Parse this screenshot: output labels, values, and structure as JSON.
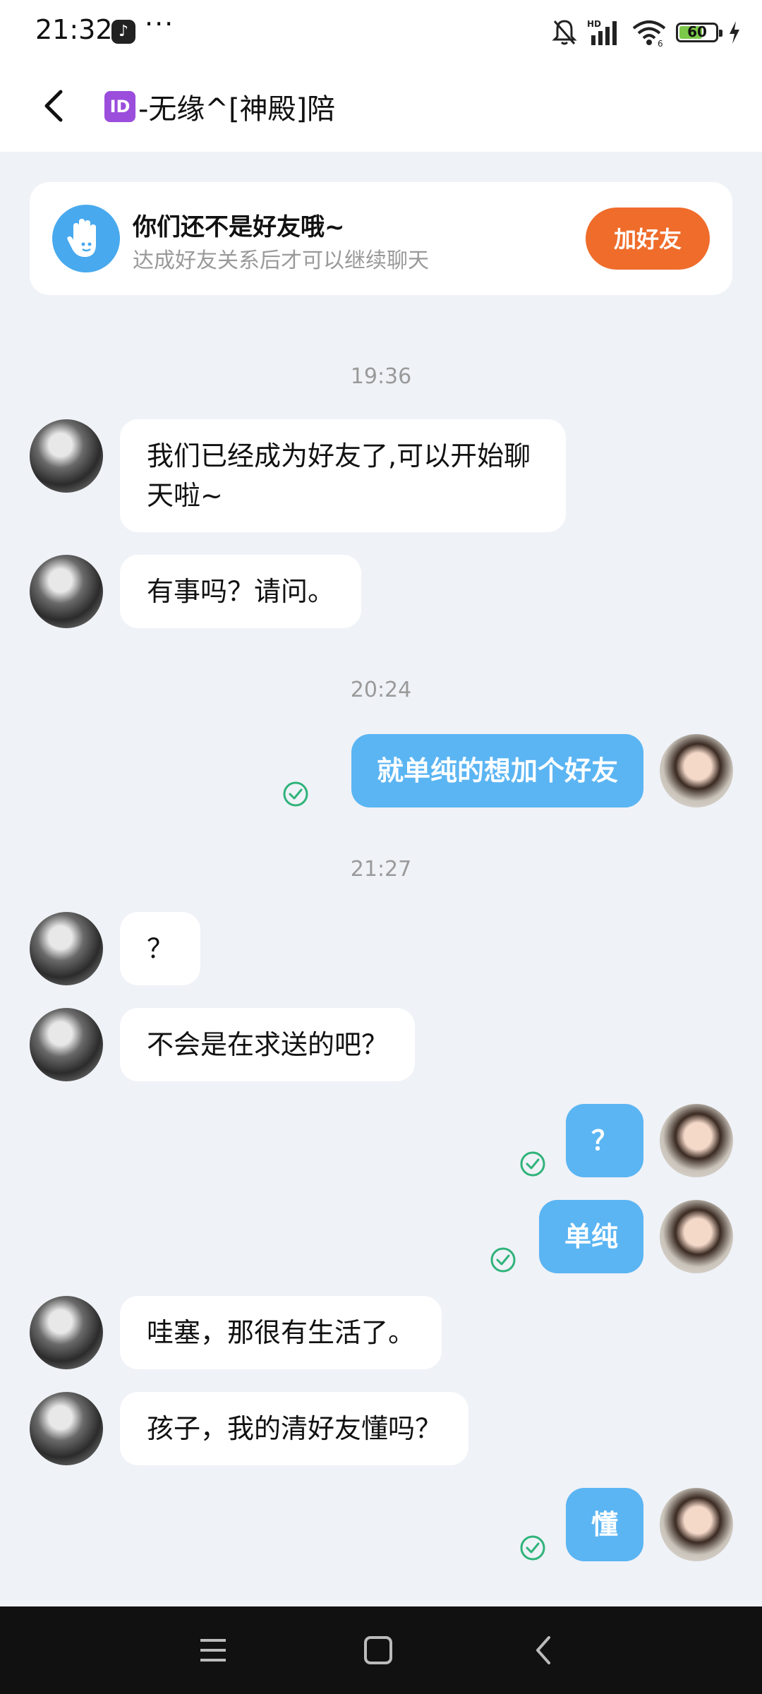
{
  "status_bar": {
    "time": "21:32",
    "app_icon": "tiktok-icon",
    "overflow": "···",
    "icons": [
      "mute-icon",
      "hd-signal-icon",
      "wifi-icon",
      "battery-icon",
      "charging-icon"
    ],
    "battery": "60"
  },
  "header": {
    "back_icon": "back-arrow-icon",
    "id_badge": "ID",
    "title": "-无缘^[神殿]陪"
  },
  "friend_card": {
    "icon": "wave-hand-icon",
    "title": "你们还不是好友哦~",
    "subtitle": "达成好友关系后才可以继续聊天",
    "button": "加好友"
  },
  "timestamps": [
    "19:36",
    "20:24",
    "21:27"
  ],
  "messages": [
    {
      "side": "in",
      "text": "我们已经成为好友了,可以开始聊天啦~"
    },
    {
      "side": "in",
      "text": "有事吗？请问。"
    },
    {
      "side": "out",
      "text": "就单纯的想加个好友",
      "status": "read"
    },
    {
      "side": "in",
      "text": "？"
    },
    {
      "side": "in",
      "text": "不会是在求送的吧？"
    },
    {
      "side": "out",
      "text": "？",
      "status": "read"
    },
    {
      "side": "out",
      "text": "单纯",
      "status": "read"
    },
    {
      "side": "in",
      "text": "哇塞，那很有生活了。"
    },
    {
      "side": "in",
      "text": "孩子，我的清好友懂吗？"
    },
    {
      "side": "out",
      "text": "懂",
      "status": "read"
    }
  ],
  "nav_bar": {
    "icons": [
      "menu-icon",
      "home-icon",
      "back-icon"
    ]
  },
  "colors": {
    "accent_blue": "#5bb5f3",
    "add_button": "#ef6c2b",
    "background": "#eff2f7",
    "check_green": "#2fb37a"
  }
}
